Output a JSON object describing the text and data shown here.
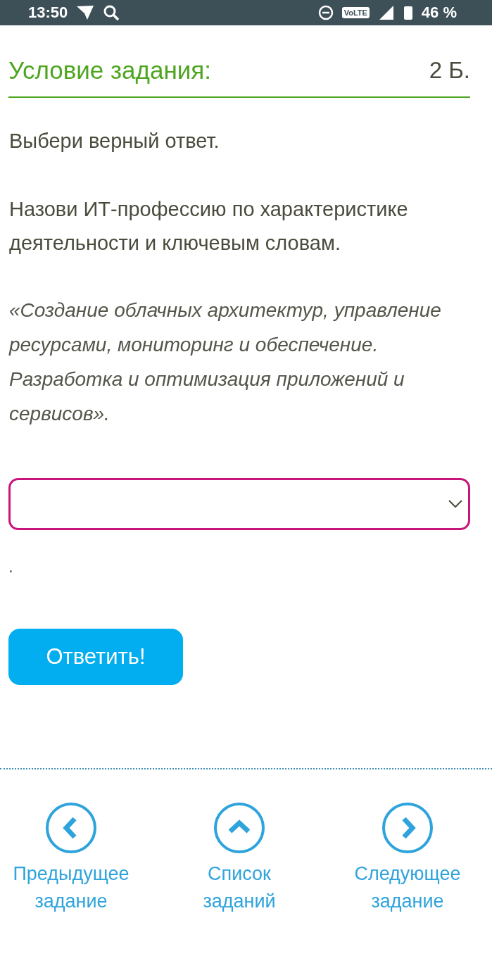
{
  "status_bar": {
    "time": "13:50",
    "network_badge": "VoLTE",
    "battery": "46 %"
  },
  "task": {
    "title": "Условие задания:",
    "points": "2 Б."
  },
  "instruction": "Выбери верный ответ.",
  "question": "Назови ИТ-профессию по характеристике деятельности и ключевым словам.",
  "quote": "«Создание облачных архитектур, управление ресурсами, мониторинг и обеспечение. Разработка и оптимизация приложений и сервисов».",
  "answer_select": {
    "highlighted": true
  },
  "trailing_text": ".",
  "submit_button": "Ответить!",
  "navigation": [
    {
      "kind": "previous",
      "label": "Предыдущее задание"
    },
    {
      "kind": "list",
      "label": "Список заданий"
    },
    {
      "kind": "next",
      "label": "Следующее задание"
    }
  ]
}
